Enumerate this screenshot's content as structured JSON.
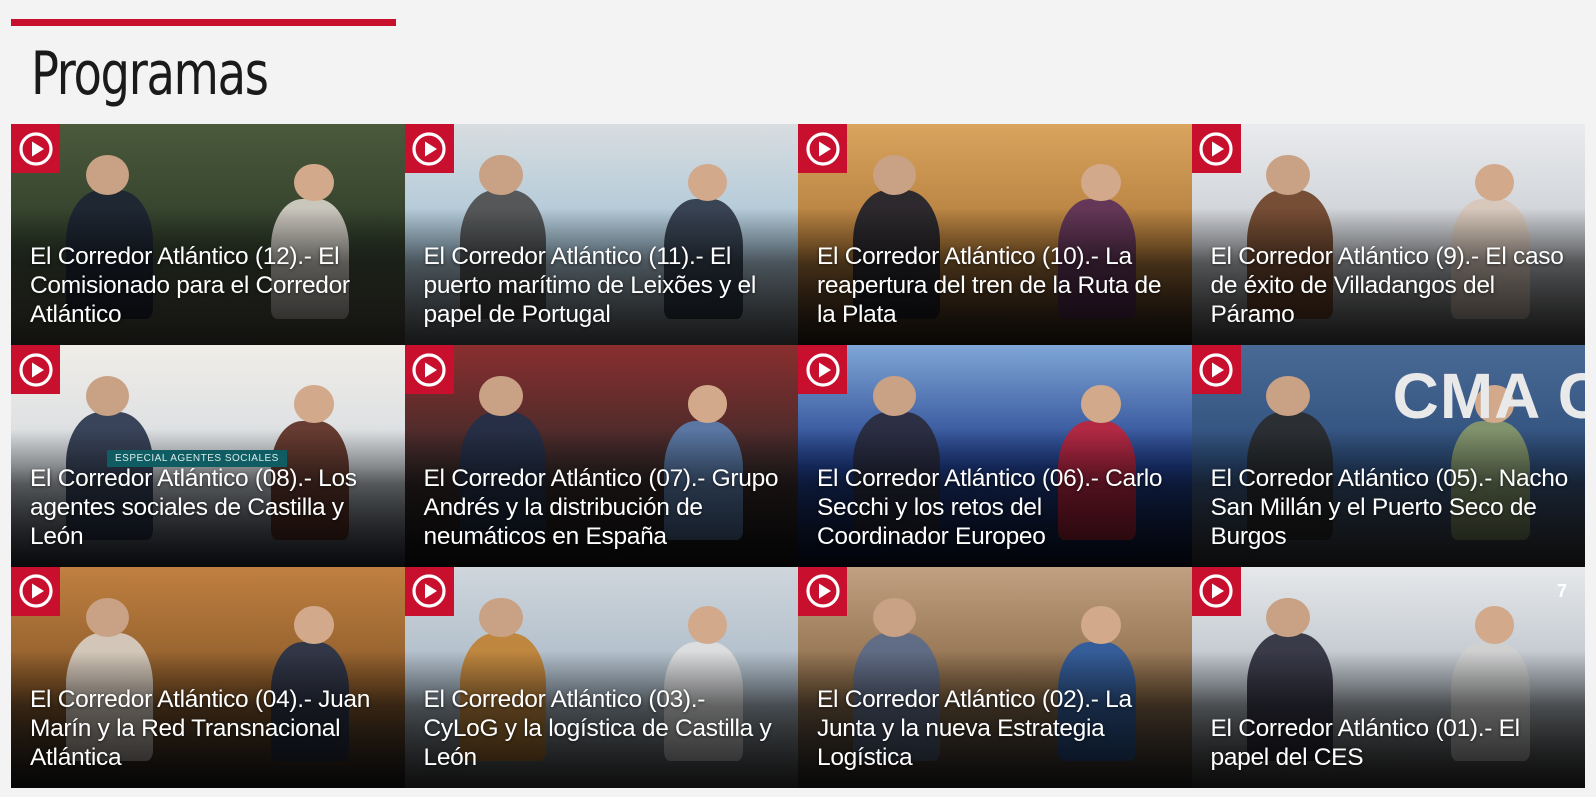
{
  "section": {
    "title": "Programas"
  },
  "programs": [
    {
      "title": "El Corredor Atlántico (12).- El Comisionado para el Corredor Atlántico",
      "scene": {
        "bg": [
          "#2f3d2a",
          "#4b5a3b"
        ],
        "floor": "#6e6a5c",
        "figures": [
          "#1c2333",
          "#d9d4cc"
        ]
      }
    },
    {
      "title": "El Corredor Atlántico (11).- El puerto marítimo de Leixões y el papel de Portugal",
      "scene": {
        "bg": [
          "#a8c4d6",
          "#d8dde0"
        ],
        "floor": "#8c8f93",
        "figures": [
          "#4a4a4a",
          "#2a3444"
        ]
      }
    },
    {
      "title": "El Corredor Atlántico (10).- La reapertura del tren de la Ruta de la Plata",
      "scene": {
        "bg": [
          "#b07a3a",
          "#d9a45e"
        ],
        "floor": "#3a2a1e",
        "figures": [
          "#1d1f2b",
          "#5a2f5a"
        ]
      }
    },
    {
      "title": "El Corredor Atlántico (9).- El caso de éxito de Villadangos del Páramo",
      "scene": {
        "bg": [
          "#c9ccd1",
          "#e9ebee"
        ],
        "floor": "#6f6f6f",
        "figures": [
          "#6b3e22",
          "#d8c6b8"
        ]
      }
    },
    {
      "title": "El Corredor Atlántico (08).- Los agentes sociales de Castilla y León",
      "badge": "ESPECIAL AGENTES SOCIALES",
      "scene": {
        "bg": [
          "#d6dbe0",
          "#f0ede8"
        ],
        "floor": "#3b4452",
        "figures": [
          "#27324a",
          "#5a2a1e"
        ]
      }
    },
    {
      "title": "El Corredor Atlántico (07).- Grupo Andrés y la distribución de neumáticos en España",
      "scene": {
        "bg": [
          "#3a2a2a",
          "#8a2e2e"
        ],
        "floor": "#1a1a1a",
        "figures": [
          "#22304a",
          "#5b7fb0"
        ]
      }
    },
    {
      "title": "El Corredor Atlántico (06).- Carlo Secchi y los retos del Coordinador Europeo",
      "scene": {
        "bg": [
          "#1f3d8a",
          "#7fa6d6"
        ],
        "floor": "#0e1a3a",
        "figures": [
          "#2a2a3a",
          "#c0243a"
        ]
      }
    },
    {
      "title": "El Corredor Atlántico (05).- Nacho San Millán y el Puerto Seco de Burgos",
      "big_text": "CMA C",
      "scene": {
        "bg": [
          "#2d4d7a",
          "#4a6a96"
        ],
        "floor": "#4a4a4a",
        "figures": [
          "#2a2a2a",
          "#8a9a6a"
        ]
      }
    },
    {
      "title": "El Corredor Atlántico (04).- Juan Marín y la Red Transnacional Atlántica",
      "scene": {
        "bg": [
          "#8a5a2a",
          "#c08040"
        ],
        "floor": "#2a2a2a",
        "figures": [
          "#d8d0c8",
          "#27324a"
        ]
      }
    },
    {
      "title": "El Corredor Atlántico (03).- CyLoG y la logística de Castilla y León",
      "scene": {
        "bg": [
          "#a9b8c6",
          "#cfd6dc"
        ],
        "floor": "#5e5e5e",
        "figures": [
          "#c08030",
          "#e0e0e0"
        ]
      }
    },
    {
      "title": "El Corredor Atlántico (02).- La Junta y la nueva Estrategia Logística",
      "scene": {
        "bg": [
          "#8a6a48",
          "#c0a080"
        ],
        "floor": "#3a3a3a",
        "figures": [
          "#5a6a8a",
          "#2a5aa0"
        ]
      }
    },
    {
      "title": "El Corredor Atlántico (01).- El papel del CES",
      "channel_logo": "7",
      "scene": {
        "bg": [
          "#b8c0c8",
          "#e6e8ea"
        ],
        "floor": "#4a4a4a",
        "figures": [
          "#2a2a3a",
          "#d0d0d0"
        ]
      }
    }
  ],
  "colors": {
    "accent": "#c8102e",
    "background": "#f3f3f3",
    "title_text": "#1a1a1a",
    "card_text": "#ffffff"
  },
  "icons": {
    "play": "play-circle-icon"
  }
}
